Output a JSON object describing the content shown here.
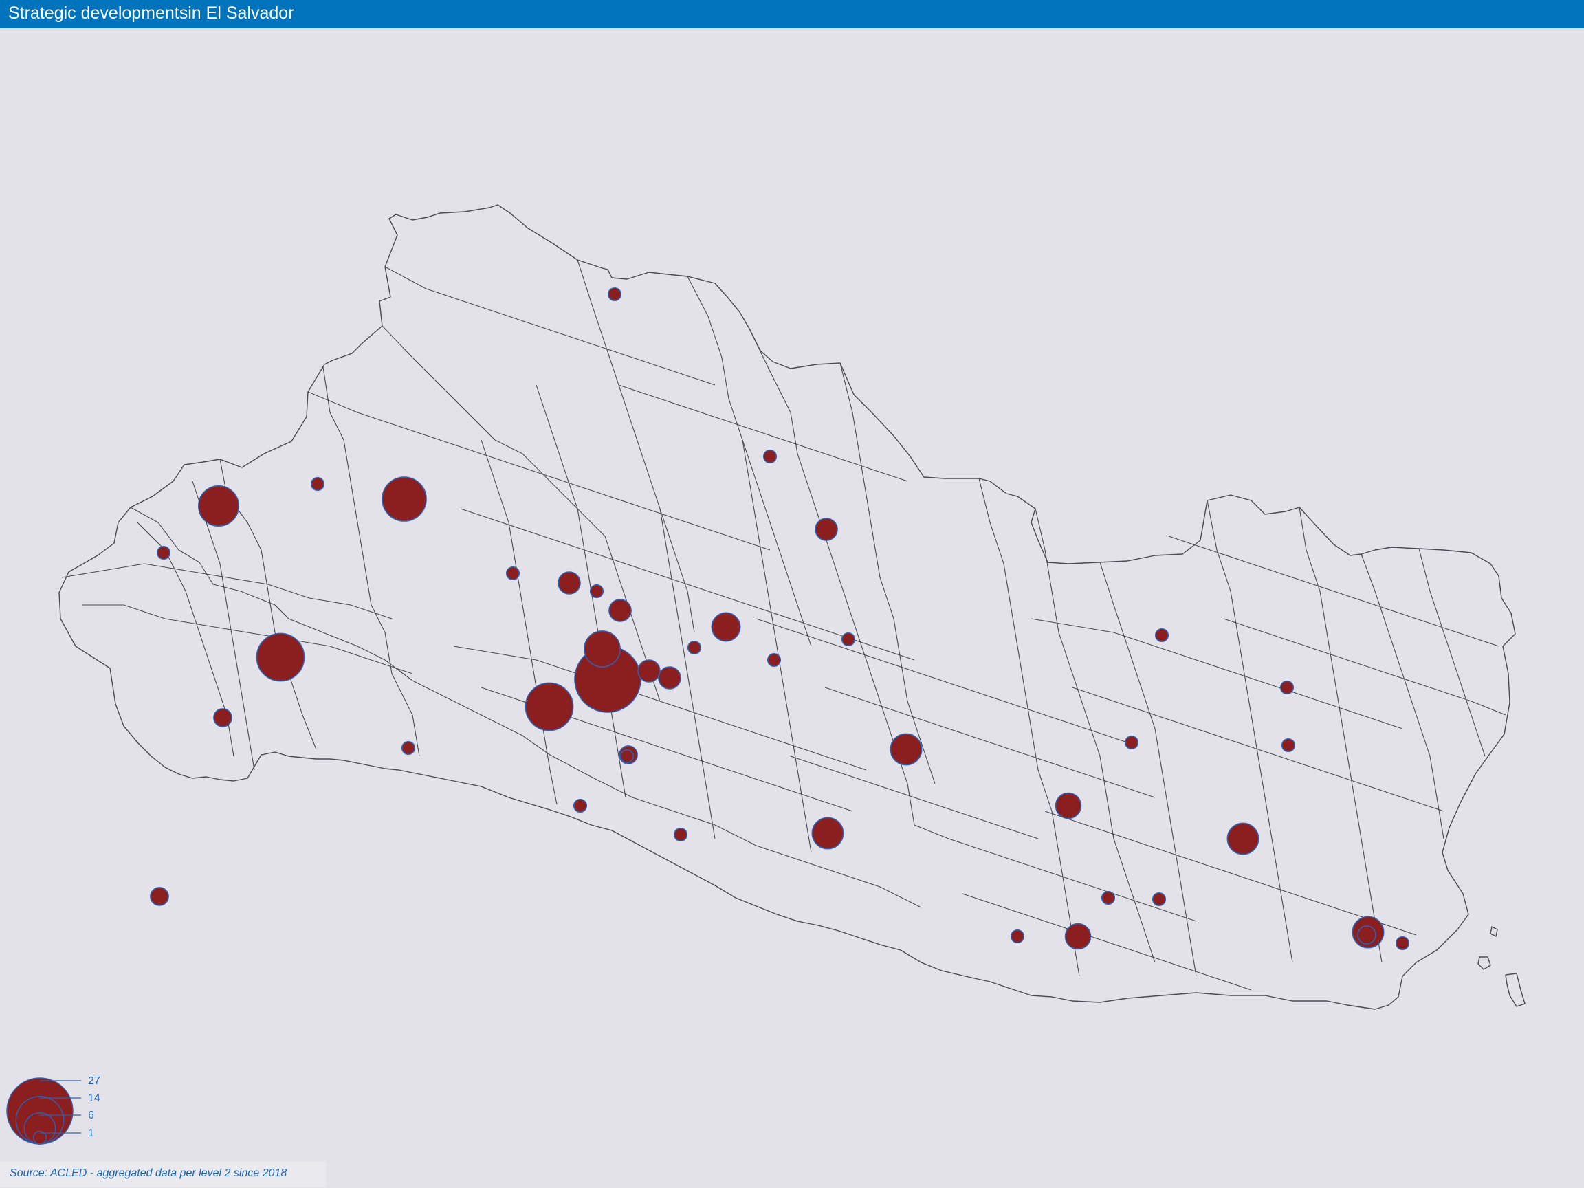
{
  "title": "Strategic developmentsin El Salvador",
  "source": "Source: ACLED - aggregated data per level 2 since 2018",
  "colors": {
    "header": "#0073bd",
    "background": "#e2e2e8",
    "bubble_fill": "#8b1e1e",
    "bubble_stroke": "#2f5fb0",
    "border_line": "#4a4a55",
    "legend_text": "#1a64b4"
  },
  "legend": {
    "values": [
      27,
      14,
      6,
      1
    ]
  },
  "events": [
    {
      "count": 27
    },
    {
      "count": 14
    },
    {
      "count": 14
    },
    {
      "count": 12
    },
    {
      "count": 10
    },
    {
      "count": 8
    },
    {
      "count": 6
    },
    {
      "count": 6
    },
    {
      "count": 6
    },
    {
      "count": 6
    },
    {
      "count": 5
    },
    {
      "count": 4
    },
    {
      "count": 4
    },
    {
      "count": 3
    },
    {
      "count": 3
    },
    {
      "count": 3
    },
    {
      "count": 3
    },
    {
      "count": 2
    },
    {
      "count": 3
    },
    {
      "count": 2
    },
    {
      "count": 2
    },
    {
      "count": 2
    },
    {
      "count": 1
    },
    {
      "count": 1
    },
    {
      "count": 1
    },
    {
      "count": 1
    },
    {
      "count": 1
    },
    {
      "count": 1
    },
    {
      "count": 1
    },
    {
      "count": 1
    },
    {
      "count": 1
    },
    {
      "count": 1
    },
    {
      "count": 1
    },
    {
      "count": 1
    },
    {
      "count": 1
    },
    {
      "count": 1
    },
    {
      "count": 1
    },
    {
      "count": 1
    },
    {
      "count": 1
    },
    {
      "count": 1
    },
    {
      "count": 1
    },
    {
      "count": 1
    },
    {
      "count": 1
    }
  ]
}
